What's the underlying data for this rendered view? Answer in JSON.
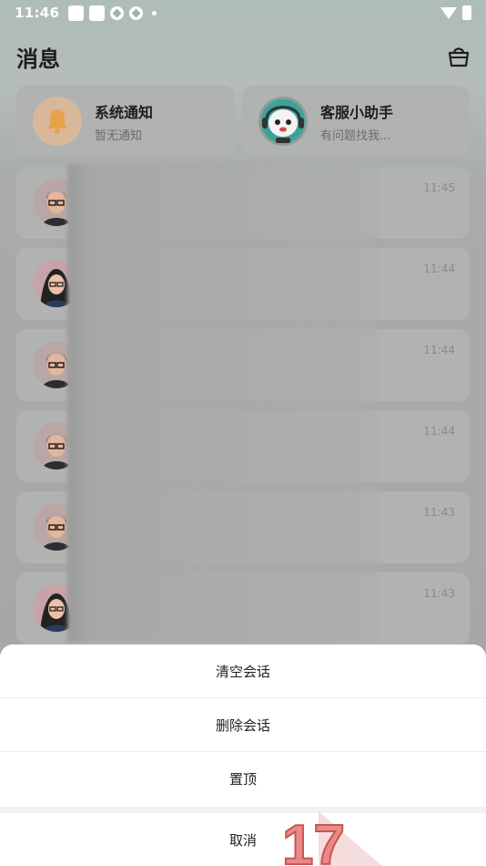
{
  "status_bar": {
    "time": "11:46"
  },
  "header": {
    "title": "消息",
    "shop_icon": "shopping-basket-icon"
  },
  "quick_cards": [
    {
      "title": "系统通知",
      "subtitle": "暂无通知",
      "icon": "bell-icon"
    },
    {
      "title": "客服小助手",
      "subtitle": "有问题找我...",
      "icon": "support-mascot-avatar"
    }
  ],
  "conversations": [
    {
      "time": "11:45",
      "avatar": "male-avatar"
    },
    {
      "time": "11:44",
      "avatar": "female-avatar"
    },
    {
      "time": "11:44",
      "avatar": "male-avatar"
    },
    {
      "time": "11:44",
      "avatar": "male-avatar"
    },
    {
      "time": "11:43",
      "avatar": "male-avatar"
    },
    {
      "time": "11:43",
      "avatar": "female-avatar"
    }
  ],
  "action_sheet": {
    "clear": "清空会话",
    "delete": "删除会话",
    "pin": "置顶",
    "cancel": "取消"
  },
  "colors": {
    "sheet_bg": "#ffffff",
    "overlay": "#a5a7a6",
    "bell_orange": "#e8a24a"
  }
}
